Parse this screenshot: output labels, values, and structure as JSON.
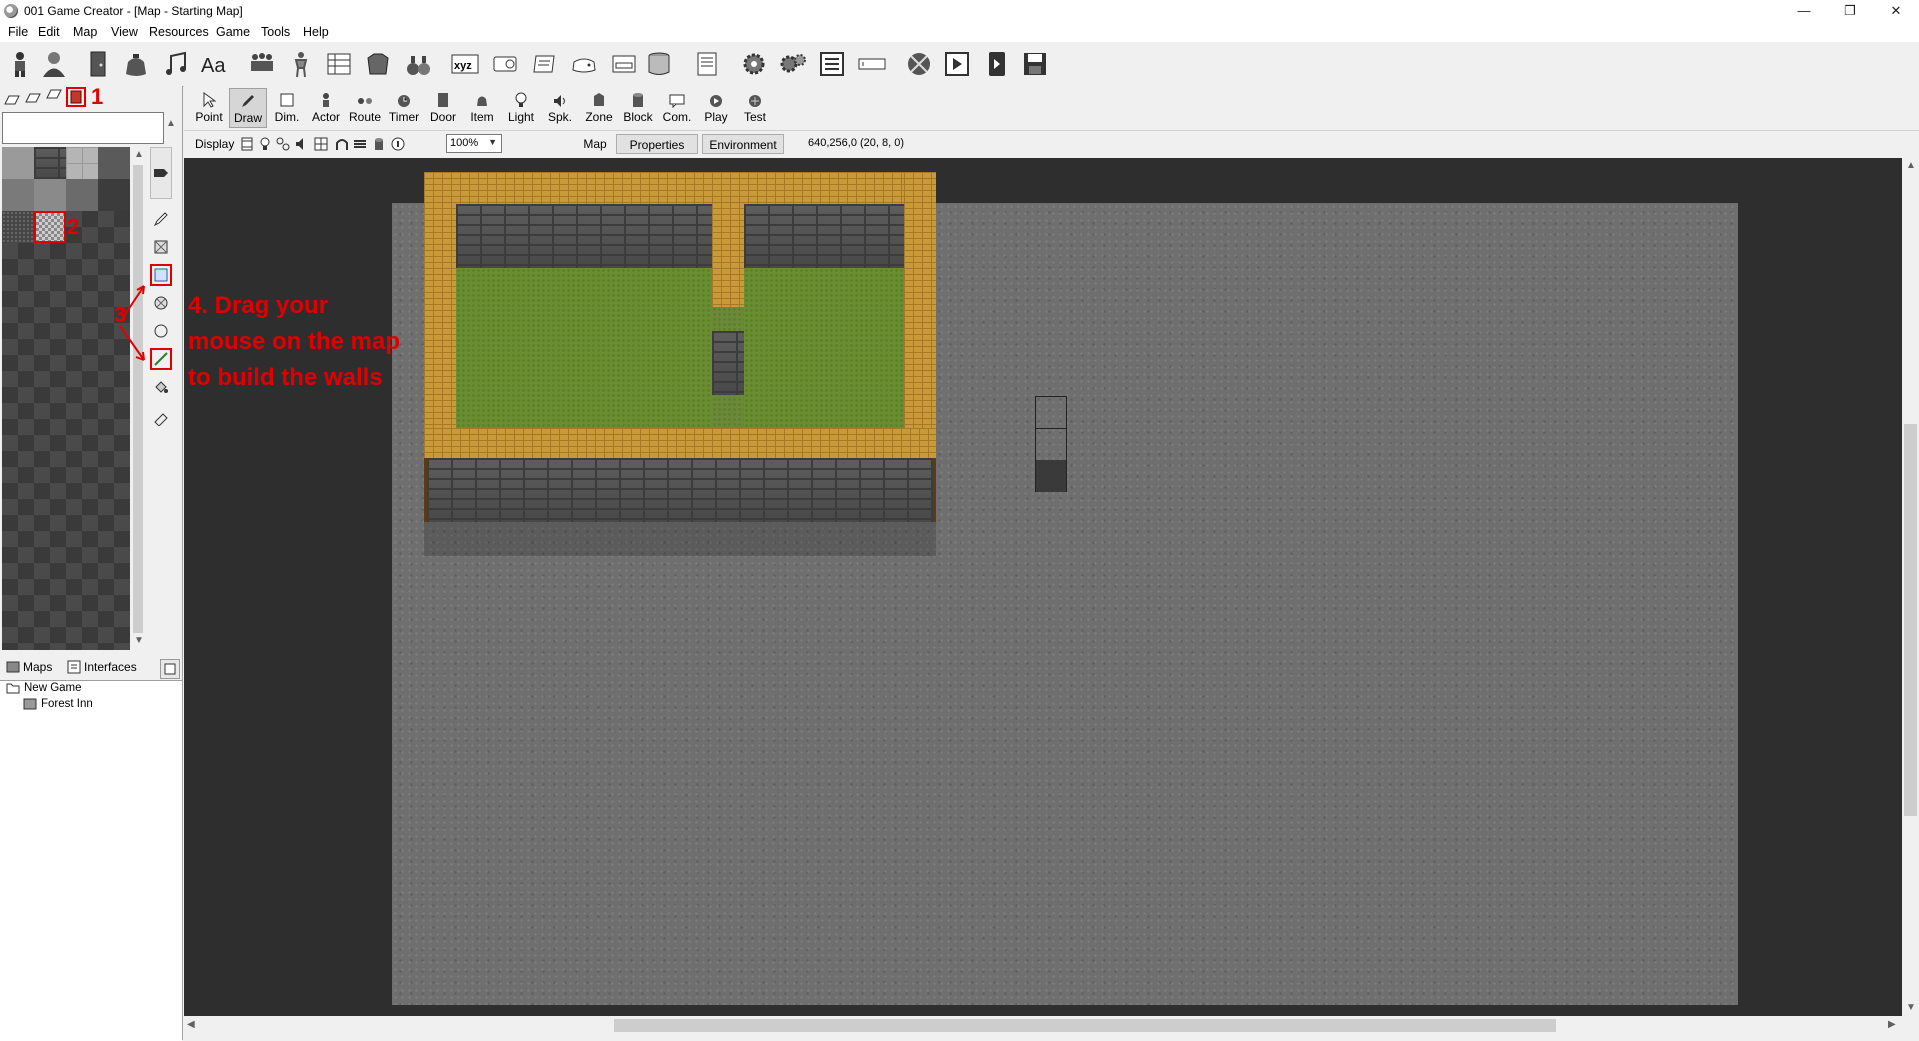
{
  "window": {
    "title": "001 Game Creator - [Map - Starting Map]",
    "controls": [
      "—",
      "❐",
      "✕"
    ]
  },
  "menu": [
    "File",
    "Edit",
    "Map",
    "View",
    "Resources",
    "Game",
    "Tools",
    "Help"
  ],
  "main_toolbar_icons": [
    "actor-icon",
    "player-icon",
    "door-icon",
    "bag-icon",
    "music-icon",
    "font-icon",
    "group-icon",
    "person-icon",
    "list-icon",
    "armor-icon",
    "potion-icon",
    "xyz-icon",
    "script-icon",
    "scroll-icon",
    "gamepad-icon",
    "interface-icon",
    "database-icon",
    "notes-icon",
    "gear-icon",
    "gears-icon",
    "text-list-icon",
    "textbox-icon",
    "globe-icon",
    "video-icon",
    "phone-icon",
    "save-icon"
  ],
  "map_tools": [
    {
      "label": "Point",
      "icon": "pointer-icon"
    },
    {
      "label": "Draw",
      "icon": "pencil-icon"
    },
    {
      "label": "Dim.",
      "icon": "dimension-icon"
    },
    {
      "label": "Actor",
      "icon": "actor-icon"
    },
    {
      "label": "Route",
      "icon": "route-icon"
    },
    {
      "label": "Timer",
      "icon": "timer-icon"
    },
    {
      "label": "Door",
      "icon": "door-icon"
    },
    {
      "label": "Item",
      "icon": "item-icon"
    },
    {
      "label": "Light",
      "icon": "light-icon"
    },
    {
      "label": "Spk.",
      "icon": "speaker-icon"
    },
    {
      "label": "Zone",
      "icon": "zone-icon"
    },
    {
      "label": "Block",
      "icon": "block-icon"
    },
    {
      "label": "Com.",
      "icon": "comment-icon"
    },
    {
      "label": "Play",
      "icon": "play-icon"
    },
    {
      "label": "Test",
      "icon": "test-icon"
    }
  ],
  "display_bar": {
    "label": "Display",
    "zoom": "100%",
    "tabs": [
      "Map",
      "Properties",
      "Environment"
    ],
    "coords": "640,256,0 (20, 8, 0)"
  },
  "left_panel": {
    "tabs": [
      "Maps",
      "Interfaces"
    ],
    "tree": {
      "root": "New Game",
      "child": "Forest Inn"
    }
  },
  "annotations": {
    "step1": "1",
    "step2": "2",
    "step3": "3",
    "step4": "4. Drag your mouse on the map to build the walls"
  },
  "colors": {
    "annotation": "#e00000",
    "map_background": "#2e2e2e",
    "brick": "#c89a3a",
    "grass": "#6a8d32"
  }
}
